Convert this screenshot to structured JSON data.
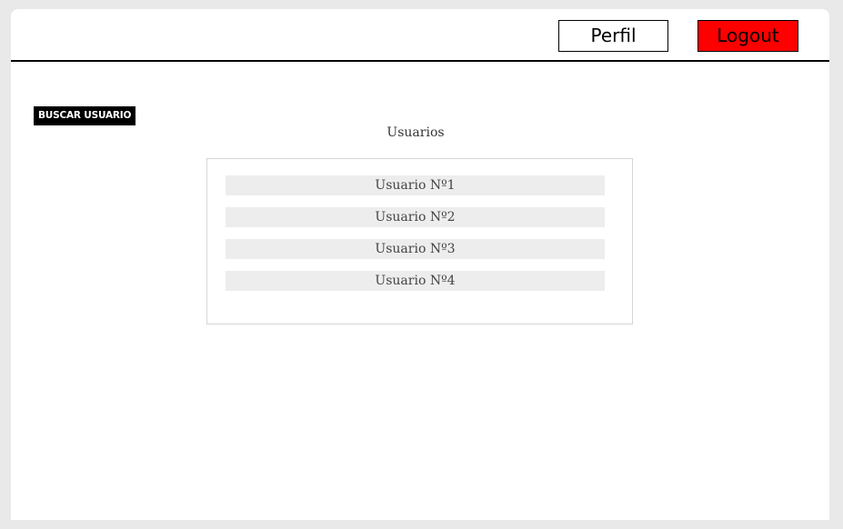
{
  "header": {
    "perfil_label": "Perfil",
    "logout_label": "Logout",
    "logout_color": "#ff0000"
  },
  "search": {
    "button_label": "BUSCAR USUARIO"
  },
  "users": {
    "title": "Usuarios",
    "items": [
      {
        "label": "Usuario Nº1"
      },
      {
        "label": "Usuario  Nº2"
      },
      {
        "label": "Usuario  Nº3"
      },
      {
        "label": "Usuario  Nº4"
      }
    ]
  }
}
